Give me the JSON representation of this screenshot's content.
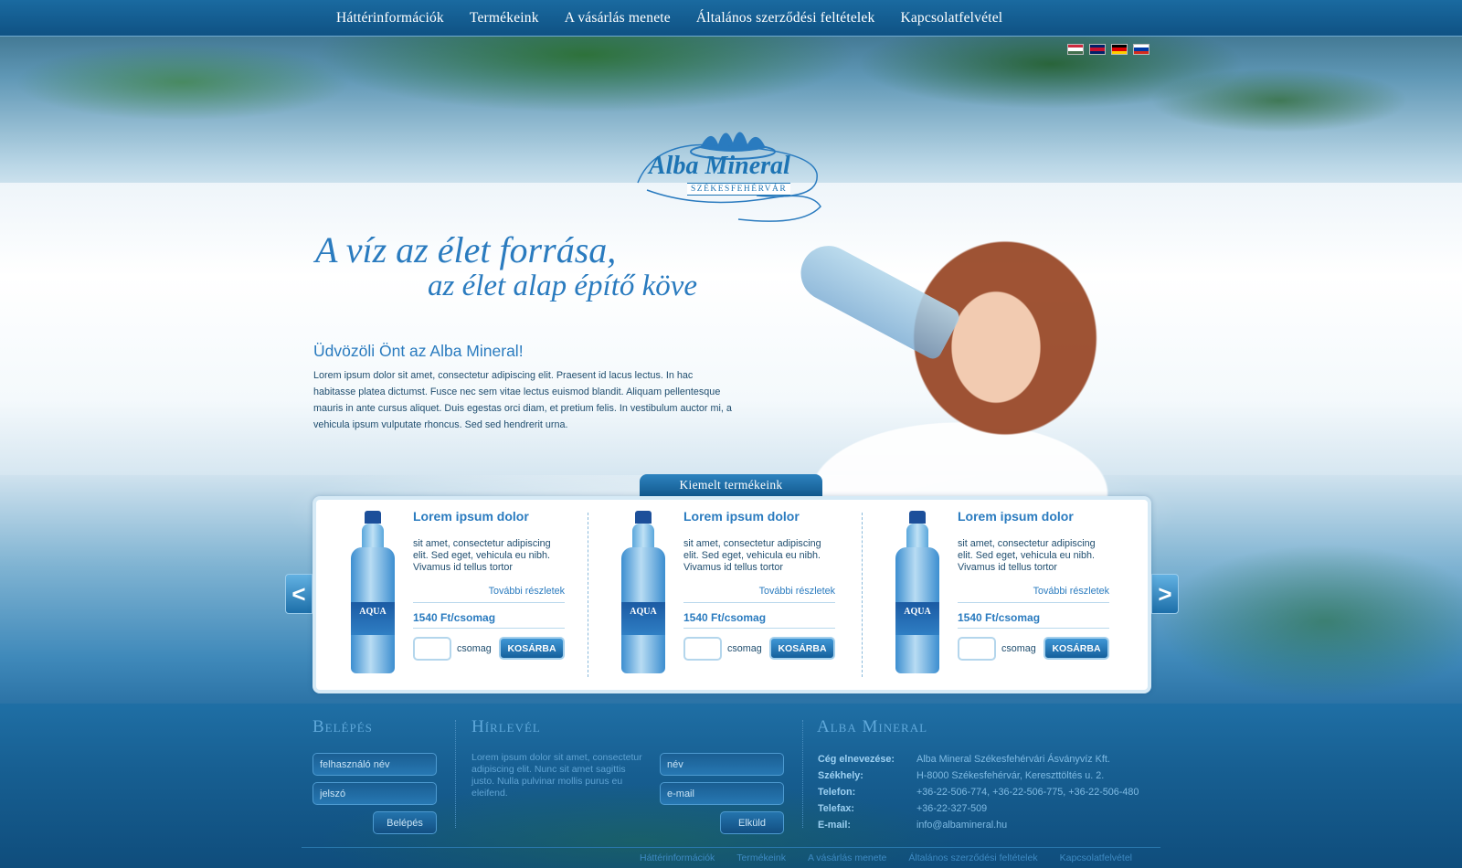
{
  "nav": {
    "items": [
      "Háttérinformációk",
      "Termékeink",
      "A vásárlás menete",
      "Általános szerződési feltételek",
      "Kapcsolatfelvétel"
    ]
  },
  "languages": [
    {
      "name": "hungarian-flag-icon",
      "colors": [
        "#cd2a3e",
        "#ffffff",
        "#436f4d"
      ]
    },
    {
      "name": "english-flag-icon",
      "colors": [
        "#012169",
        "#c8102e",
        "#012169"
      ]
    },
    {
      "name": "german-flag-icon",
      "colors": [
        "#000000",
        "#dd0000",
        "#ffce00"
      ]
    },
    {
      "name": "russian-flag-icon",
      "colors": [
        "#ffffff",
        "#0039a6",
        "#d52b1e"
      ]
    }
  ],
  "logo": {
    "name": "Alba Mineral",
    "city": "SZÉKESFEHÉRVÁR"
  },
  "tagline": {
    "line1": "A víz az élet forrása,",
    "line2": "az élet alap építő köve"
  },
  "welcome": {
    "title": "Üdvözöli Önt az Alba Mineral!",
    "text": "Lorem ipsum dolor sit amet, consectetur adipiscing elit. Praesent id lacus lectus. In hac habitasse platea dictumst. Fusce nec sem vitae lectus euismod blandit. Aliquam pellentesque mauris in ante cursus aliquet. Duis egestas orci diam, et pretium felis. In vestibulum auctor mi, a vehicula ipsum vulputate rhoncus. Sed sed hendrerit urna."
  },
  "featured": {
    "tab_label": "Kiemelt termékeink",
    "prev_symbol": "<",
    "next_symbol": ">",
    "products": [
      {
        "title": "Lorem ipsum dolor",
        "desc": "sit amet, consectetur adipiscing elit. Sed eget, vehicula eu nibh. Vivamus id tellus tortor",
        "more": "További részletek",
        "price": "1540 Ft/csomag",
        "unit": "csomag",
        "cart": "KOSÁRBA",
        "bottle_label": "AQUA"
      },
      {
        "title": "Lorem ipsum dolor",
        "desc": "sit amet, consectetur adipiscing elit. Sed eget, vehicula eu nibh. Vivamus id tellus tortor",
        "more": "További részletek",
        "price": "1540 Ft/csomag",
        "unit": "csomag",
        "cart": "KOSÁRBA",
        "bottle_label": "AQUA"
      },
      {
        "title": "Lorem ipsum dolor",
        "desc": "sit amet, consectetur adipiscing elit. Sed eget, vehicula eu nibh. Vivamus id tellus tortor",
        "more": "További részletek",
        "price": "1540 Ft/csomag",
        "unit": "csomag",
        "cart": "KOSÁRBA",
        "bottle_label": "AQUA"
      }
    ]
  },
  "login": {
    "heading": "Belépés",
    "username_placeholder": "felhasználó név",
    "password_placeholder": "jelszó",
    "button": "Belépés"
  },
  "newsletter": {
    "heading": "Hírlevél",
    "text": "Lorem ipsum dolor sit amet, consectetur adipiscing elit. Nunc sit amet sagittis justo. Nulla pulvinar mollis purus eu eleifend.",
    "name_placeholder": "név",
    "email_placeholder": "e-mail",
    "button": "Elküld"
  },
  "company": {
    "heading": "Alba Mineral",
    "rows": [
      {
        "key": "Cég elnevezése:",
        "value": "Alba Mineral Székesfehérvári Ásványvíz Kft."
      },
      {
        "key": "Székhely:",
        "value": "H-8000 Székesfehérvár, Kereszttöltés u. 2."
      },
      {
        "key": "Telefon:",
        "value": "+36-22-506-774, +36-22-506-775, +36-22-506-480"
      },
      {
        "key": "Telefax:",
        "value": "+36-22-327-509"
      },
      {
        "key": "E-mail:",
        "value": "info@albamineral.hu"
      }
    ]
  },
  "bottom_nav": [
    "Háttérinformációk",
    "Termékeink",
    "A vásárlás menete",
    "Általános szerződési feltételek",
    "Kapcsolatfelvétel"
  ]
}
